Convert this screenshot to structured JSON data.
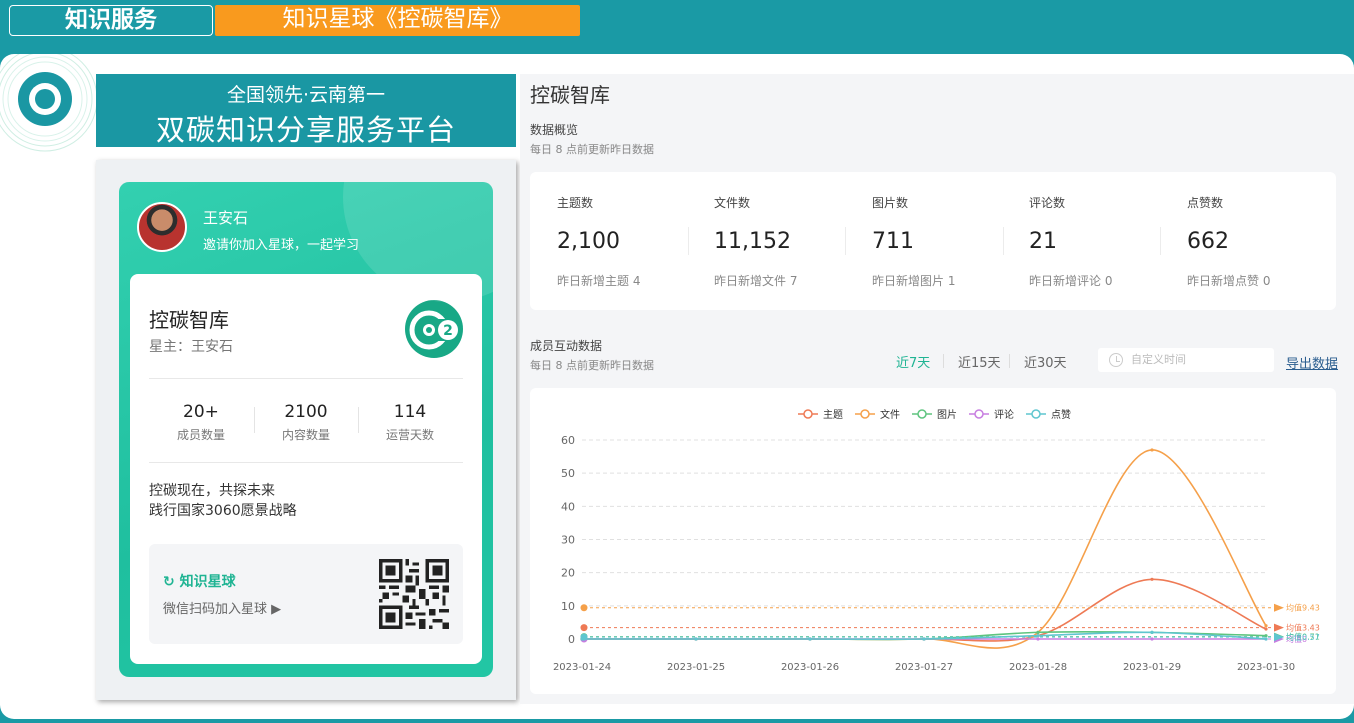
{
  "header": {
    "tab_knowledge": "知识服务",
    "tab_planet": "知识星球《控碳智库》"
  },
  "banner": {
    "subtitle": "全国领先·云南第一",
    "title": "双碳知识分享服务平台"
  },
  "card": {
    "owner_name": "王安石",
    "invite_text": "邀请你加入星球，一起学习",
    "planet_name": "控碳智库",
    "planet_owner": "星主：王安石",
    "co2_label": "2",
    "stats": [
      {
        "value": "20+",
        "label": "成员数量"
      },
      {
        "value": "2100",
        "label": "内容数量"
      },
      {
        "value": "114",
        "label": "运营天数"
      }
    ],
    "slogan_line1": "控碳现在，共探未来",
    "slogan_line2": "践行国家3060愿景战略",
    "brand": "知识星球",
    "scan_text": "微信扫码加入星球 ▶"
  },
  "main": {
    "title": "控碳智库",
    "overview_title": "数据概览",
    "overview_note": "每日 8 点前更新昨日数据",
    "overview": [
      {
        "label": "主题数",
        "value": "2,100",
        "increase": "昨日新增主题 4"
      },
      {
        "label": "文件数",
        "value": "11,152",
        "increase": "昨日新增文件 7"
      },
      {
        "label": "图片数",
        "value": "711",
        "increase": "昨日新增图片 1"
      },
      {
        "label": "评论数",
        "value": "21",
        "increase": "昨日新增评论 0"
      },
      {
        "label": "点赞数",
        "value": "662",
        "increase": "昨日新增点赞 0"
      }
    ],
    "interaction_title": "成员互动数据",
    "interaction_note": "每日 8 点前更新昨日数据",
    "ranges": [
      "近7天",
      "近15天",
      "近30天"
    ],
    "active_range": "近7天",
    "custom_time_placeholder": "自定义时间",
    "export_label": "导出数据"
  },
  "chart_data": {
    "type": "line",
    "x": [
      "2023-01-24",
      "2023-01-25",
      "2023-01-26",
      "2023-01-27",
      "2023-01-28",
      "2023-01-29",
      "2023-01-30"
    ],
    "ylim": [
      0,
      60
    ],
    "yticks": [
      0,
      10,
      20,
      30,
      40,
      50,
      60
    ],
    "grid": true,
    "legend_position": "top",
    "smooth": true,
    "series": [
      {
        "name": "主题",
        "color": "#ee7a55",
        "values": [
          0,
          0,
          0,
          0,
          1,
          18,
          3
        ],
        "avg_label": "均值3.43",
        "avg": 3.43
      },
      {
        "name": "文件",
        "color": "#f5a04a",
        "values": [
          0,
          0,
          0,
          0,
          2,
          57,
          4
        ],
        "avg_label": "均值9.43",
        "avg": 9.43
      },
      {
        "name": "图片",
        "color": "#5ec47f",
        "values": [
          0,
          0,
          0,
          0,
          2,
          2,
          1
        ],
        "avg_label": "均值0.71",
        "avg": 0.71
      },
      {
        "name": "评论",
        "color": "#c77de0",
        "values": [
          0,
          0,
          0,
          0,
          0,
          0,
          0
        ],
        "avg_label": "均值0",
        "avg": 0
      },
      {
        "name": "点赞",
        "color": "#5fc6cf",
        "values": [
          0,
          0,
          0,
          0,
          1,
          2,
          0
        ],
        "avg_label": "均值0.57",
        "avg": 0.57
      }
    ]
  }
}
